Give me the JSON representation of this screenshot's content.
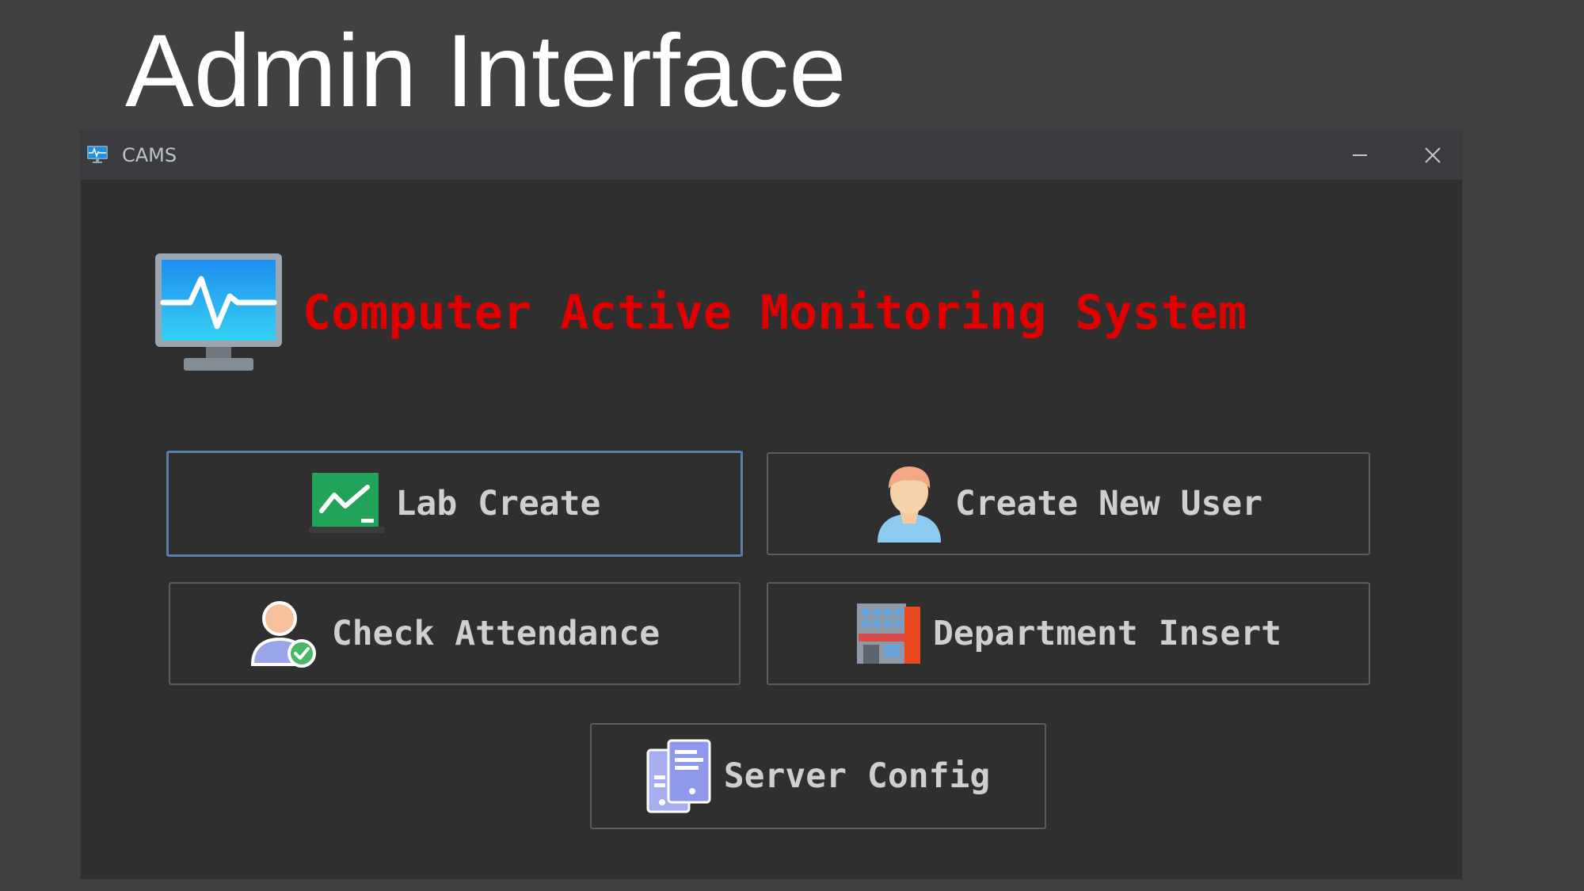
{
  "slide": {
    "title": "Admin Interface"
  },
  "window": {
    "title": "CAMS",
    "app_icon": "monitor-pulse-icon",
    "controls": {
      "minimize_icon": "minimize-icon",
      "close_icon": "close-icon"
    }
  },
  "header": {
    "logo_icon": "monitor-pulse-icon",
    "title": "Computer Active Monitoring System",
    "title_color": "#e00000"
  },
  "buttons": {
    "lab_create": {
      "label": "Lab Create",
      "icon": "chart-board-icon",
      "focused": true
    },
    "create_new_user": {
      "label": "Create New User",
      "icon": "user-icon"
    },
    "check_attendance": {
      "label": "Check Attendance",
      "icon": "user-check-icon"
    },
    "department_insert": {
      "label": "Department Insert",
      "icon": "building-icon"
    },
    "server_config": {
      "label": "Server Config",
      "icon": "server-icon"
    }
  },
  "colors": {
    "slide_background": "#414141",
    "window_background": "#2f2f2f",
    "titlebar_background": "#3a3c40",
    "focus_border": "#5a80b0",
    "button_text": "#cfcfcf"
  }
}
